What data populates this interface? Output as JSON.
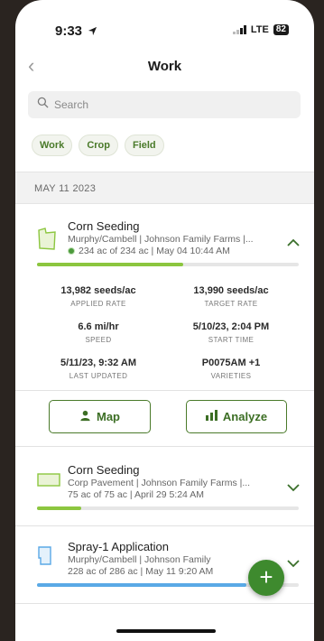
{
  "status": {
    "time": "9:33",
    "network": "LTE",
    "battery": "82"
  },
  "header": {
    "title": "Work",
    "back_glyph": "‹"
  },
  "search": {
    "placeholder": "Search"
  },
  "filters": [
    "Work",
    "Crop",
    "Field"
  ],
  "section": {
    "date": "MAY 11 2023"
  },
  "cards": [
    {
      "title": "Corn Seeding",
      "subtitle": "Murphy/Cambell | Johnson Family Farms |...",
      "meta": "234 ac of 234 ac | May 04 10:44 AM",
      "progress": 0.56,
      "color": "#8cc63f",
      "expanded": true
    },
    {
      "title": "Corn Seeding",
      "subtitle": "Corp Pavement | Johnson Family Farms |...",
      "meta": "75 ac of 75 ac | April 29 5:24 AM",
      "progress": 0.17,
      "color": "#8cc63f",
      "expanded": false
    },
    {
      "title": "Spray-1 Application",
      "subtitle": "Murphy/Cambell | Johnson Family",
      "meta": "228 ac of 286 ac | May 11 9:20 AM",
      "progress": 0.8,
      "color": "#5aa9e6",
      "expanded": false
    }
  ],
  "details": {
    "applied_rate": {
      "value": "13,982 seeds/ac",
      "label": "APPLIED RATE"
    },
    "target_rate": {
      "value": "13,990 seeds/ac",
      "label": "TARGET RATE"
    },
    "speed": {
      "value": "6.6 mi/hr",
      "label": "SPEED"
    },
    "start_time": {
      "value": "5/10/23, 2:04 PM",
      "label": "START TIME"
    },
    "last_updated": {
      "value": "5/11/23, 9:32 AM",
      "label": "LAST UPDATED"
    },
    "varieties": {
      "value": "P0075AM +1",
      "label": "VARIETIES"
    }
  },
  "actions": {
    "map": "Map",
    "analyze": "Analyze"
  },
  "fab": "+",
  "colors": {
    "brand_green": "#3e8a2e",
    "accent_green": "#8cc63f",
    "spray_blue": "#5aa9e6"
  },
  "icons": [
    "location-arrow-icon",
    "signal-icon",
    "battery-icon",
    "back-chevron-icon",
    "search-icon",
    "field-icon",
    "chevron-up-icon",
    "chevron-down-icon",
    "person-pin-icon",
    "bar-chart-icon",
    "plus-icon"
  ]
}
